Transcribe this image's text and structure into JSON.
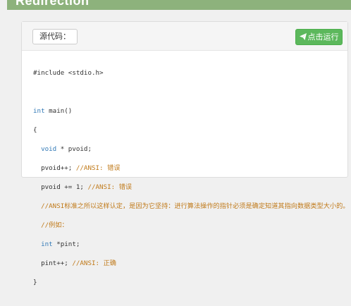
{
  "page": {
    "title": "Redirection"
  },
  "header": {
    "source_label": "源代码：",
    "run_label": "点击运行",
    "run_icon": "paper-plane-icon"
  },
  "colors": {
    "top_bar": "#8db27c",
    "run_button": "#5cb85c",
    "keyword": "#337ab7",
    "comment": "#c07a1a"
  },
  "code": {
    "include": "#include <stdio.h>",
    "main_type": "int",
    "main_name": " main()",
    "open_brace": "{",
    "l1_type": "  void",
    "l1_rest": " * pvoid;",
    "l2_code": "  pvoid++; ",
    "l2_comment": "//ANSI: 错误",
    "l3_code": "  pvoid += 1; ",
    "l3_comment": "//ANSI: 错误",
    "l4_comment": "  //ANSI标准之所以这样认定，是因为它坚持：进行算法操作的指针必须是确定知道其指向数据类型大小的。",
    "l5_comment": "  //例如：",
    "l6_type": "  int",
    "l6_rest": " *pint;",
    "l7_code": "  pint++; ",
    "l7_comment": "//ANSI: 正确",
    "close_brace": "}"
  }
}
